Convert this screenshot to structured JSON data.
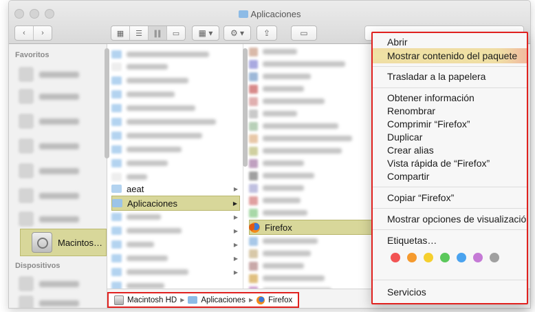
{
  "window": {
    "title": "Aplicaciones"
  },
  "sidebar": {
    "favorites_header": "Favoritos",
    "devices_header": "Dispositivos",
    "selected_item": "Macintos…"
  },
  "column1": {
    "visible_items": [
      {
        "label": "aeat",
        "has_children": true
      },
      {
        "label": "Aplicaciones",
        "has_children": true,
        "selected": true
      }
    ]
  },
  "column2": {
    "visible_items": [
      {
        "label": "Firefox",
        "selected": true
      }
    ]
  },
  "pathbar": {
    "segments": [
      "Macintosh HD",
      "Aplicaciones",
      "Firefox"
    ]
  },
  "context_menu": {
    "groups": [
      [
        "Abrir",
        "Mostrar contenido del paquete"
      ],
      [
        "Trasladar a la papelera"
      ],
      [
        "Obtener información",
        "Renombrar",
        "Comprimir “Firefox”",
        "Duplicar",
        "Crear alias",
        "Vista rápida de “Firefox”",
        "Compartir"
      ],
      [
        "Copiar “Firefox”"
      ],
      [
        "Mostrar opciones de visualización"
      ],
      [
        "Etiquetas…"
      ],
      [
        "Servicios"
      ]
    ],
    "highlighted_item": "Mostrar contenido del paquete",
    "tag_colors": [
      "#f25454",
      "#f59a2e",
      "#f5cf2e",
      "#5bc85b",
      "#4aa3ef",
      "#c57ad6",
      "#a0a0a0"
    ]
  },
  "icons": {
    "folder": "folder-icon",
    "firefox": "firefox-icon",
    "disk": "hard-disk-icon",
    "gear": "gear-icon",
    "share": "share-icon",
    "tag": "tag-icon"
  }
}
